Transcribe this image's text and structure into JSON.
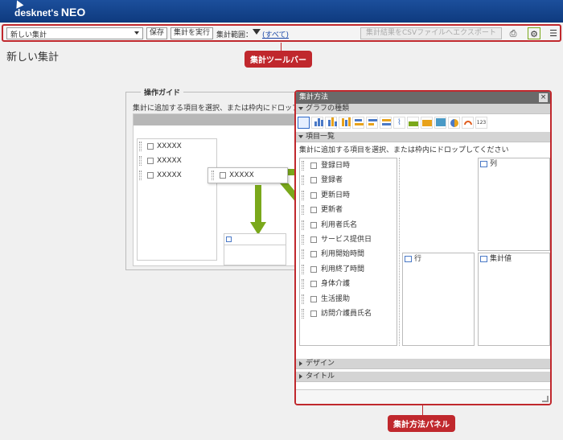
{
  "header": {
    "logo_text": "desknet's",
    "logo_neo": "NEO"
  },
  "toolbar": {
    "select_value": "新しい集計",
    "save_label": "保存",
    "run_label": "集計を実行",
    "range_label": "集計範囲：",
    "range_link": "(すべて)",
    "csv_label": "集計結果をCSVファイルへエクスポート"
  },
  "callouts": {
    "toolbar": "集計ツールバー",
    "panel": "集計方法パネル"
  },
  "page": {
    "title": "新しい集計"
  },
  "guide": {
    "legend": "操作ガイド",
    "hint": "集計に追加する項目を選択、または枠内にドロップ",
    "items": [
      "XXXXX",
      "XXXXX",
      "XXXXX"
    ],
    "drag_item": "XXXXX"
  },
  "panel": {
    "title": "集計方法",
    "close": "×",
    "graph_section": "グラフの種類",
    "items_section": "項目一覧",
    "items_hint": "集計に追加する項目を選択、または枠内にドロップしてください",
    "items": [
      "登録日時",
      "登録者",
      "更新日時",
      "更新者",
      "利用者氏名",
      "サービス提供日",
      "利用開始時間",
      "利用終了時間",
      "身体介護",
      "生活援助",
      "訪問介護員氏名"
    ],
    "column_label": "列",
    "row_label": "行",
    "value_label": "集計値",
    "design_section": "デザイン",
    "title_section": "タイトル",
    "num_icon": "123"
  },
  "colors": {
    "accent": "#c0282d",
    "header": "#0e3a7e",
    "arrow": "#7aa81b",
    "link": "#1a47a8"
  }
}
